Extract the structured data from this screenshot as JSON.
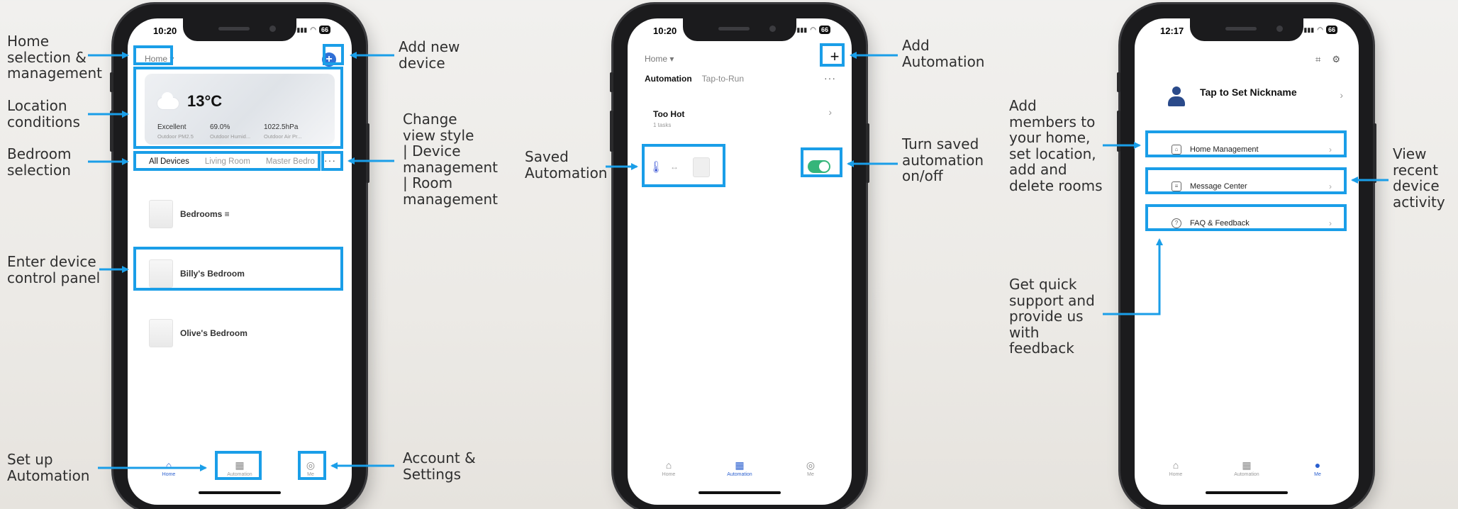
{
  "phones": [
    {
      "status_time": "10:20",
      "battery": "66",
      "home_selector": "Home ▾",
      "add_icon": "plus-circle-icon",
      "weather": {
        "temp": "13°C",
        "metrics": [
          {
            "value": "Excellent",
            "label": "Outdoor PM2.5"
          },
          {
            "value": "69.0%",
            "label": "Outdoor Humid..."
          },
          {
            "value": "1022.5hPa",
            "label": "Outdoor Air Pr..."
          }
        ]
      },
      "tabs": [
        "All Devices",
        "Living Room",
        "Master Bedro"
      ],
      "more": "···",
      "devices": [
        "Bedrooms ≡",
        "Billy's Bedroom",
        "Olive's Bedroom"
      ],
      "tabbar": [
        "Home",
        "Automation",
        "Me"
      ]
    },
    {
      "status_time": "10:20",
      "battery": "66",
      "home_selector": "Home ▾",
      "add_icon": "plus-icon",
      "tabs": [
        "Automation",
        "Tap-to-Run"
      ],
      "more": "···",
      "rule": {
        "title": "Too Hot",
        "sub": "1 tasks"
      },
      "toggle_on": true,
      "tabbar": [
        "Home",
        "Automation",
        "Me"
      ]
    },
    {
      "status_time": "12:17",
      "battery": "66",
      "nickname": "Tap to Set Nickname",
      "menu": [
        "Home Management",
        "Message Center",
        "FAQ & Feedback"
      ],
      "tabbar": [
        "Home",
        "Automation",
        "Me"
      ]
    }
  ],
  "annotations": {
    "home_sel": "Home\nselection &\nmanagement",
    "location": "Location\nconditions",
    "bedroom_sel": "Bedroom\nselection",
    "enter_device": "Enter device\ncontrol panel",
    "setup_auto": "Set up\nAutomation",
    "add_device": "Add new\ndevice",
    "change_view": "Change\nview style\n| Device\nmanagement\n| Room\nmanagement",
    "account": "Account &\nSettings",
    "saved_auto": "Saved\nAutomation",
    "add_auto": "Add\nAutomation",
    "turn_saved": "Turn saved\nautomation\non/off",
    "add_members": "Add\nmembers to\nyour home,\nset location,\nadd and\ndelete rooms",
    "view_recent": "View\nrecent\ndevice\nactivity",
    "get_support": "Get quick\nsupport and\nprovide us\nwith\nfeedback"
  },
  "colors": {
    "highlight": "#1a9ee8",
    "accent": "#2a5fcf",
    "toggle": "#35b57a"
  }
}
